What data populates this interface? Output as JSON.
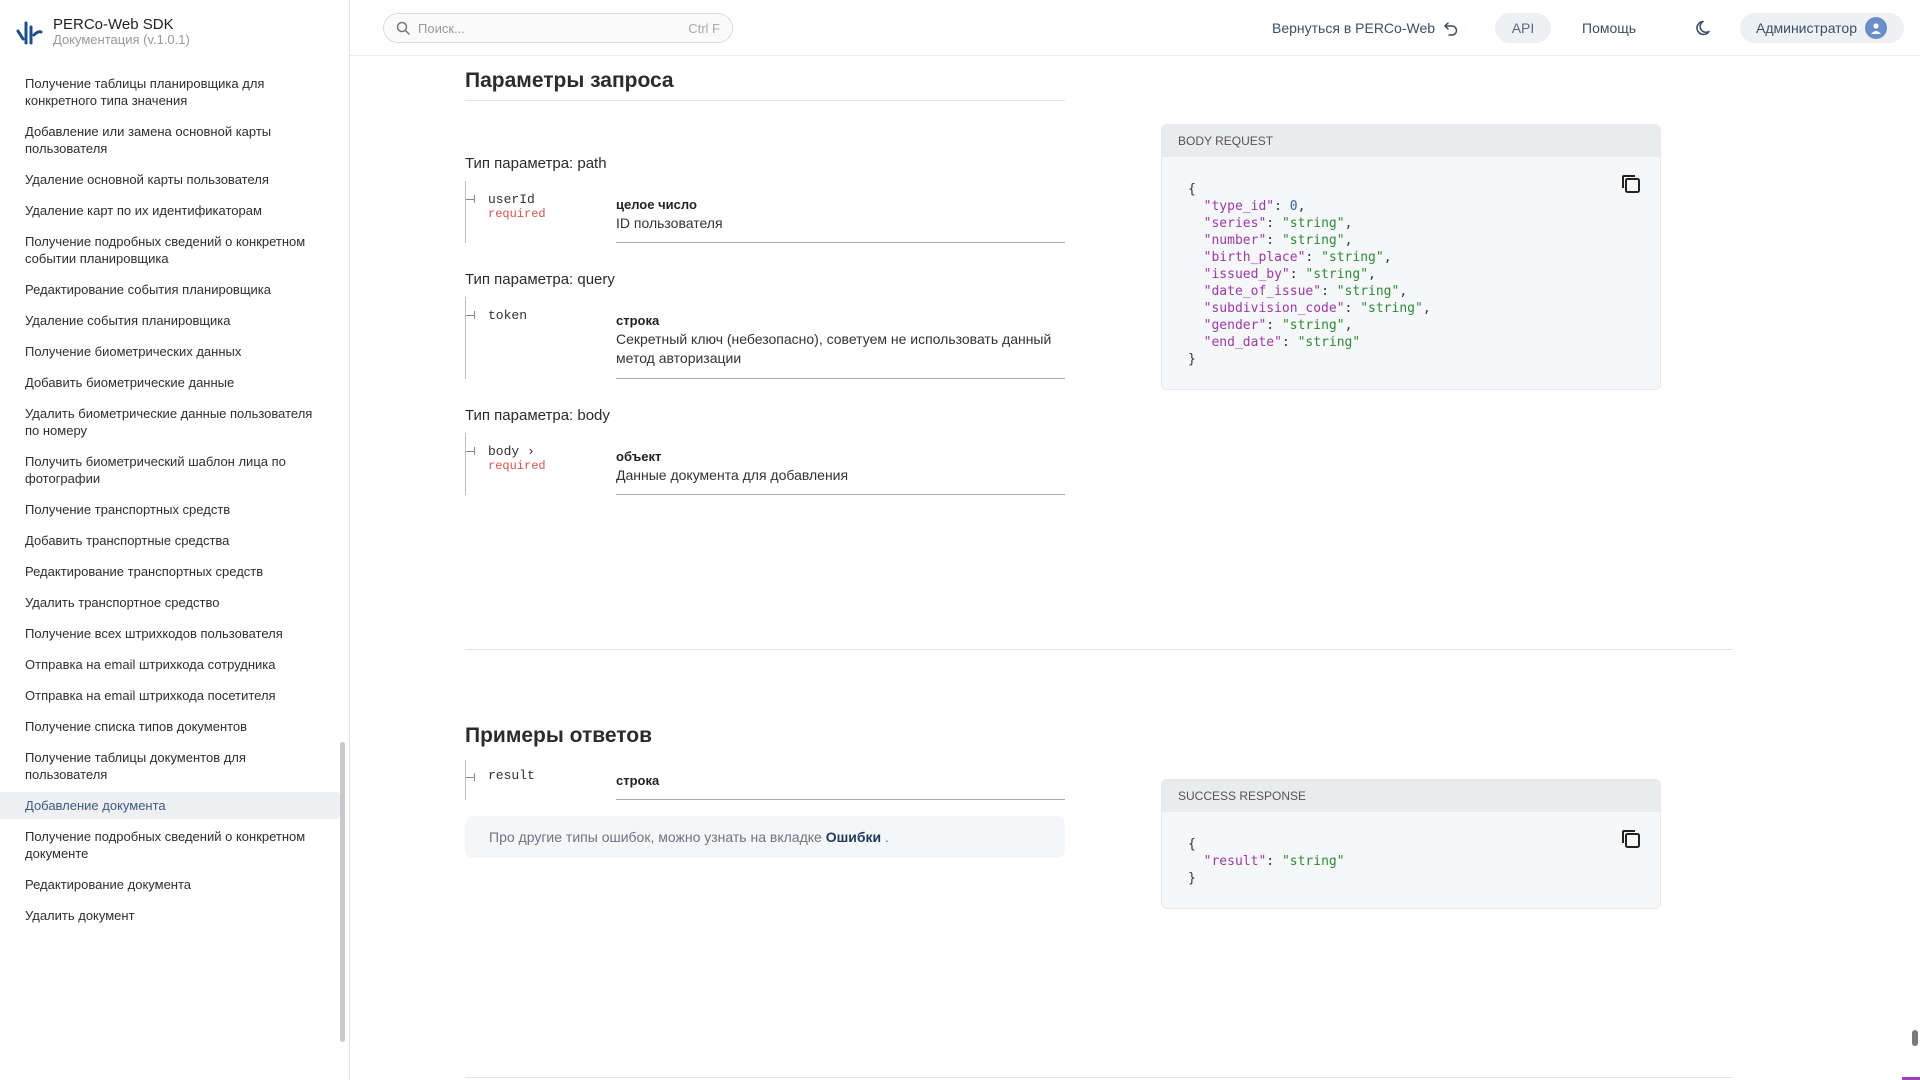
{
  "brand": {
    "title": "PERCo-Web SDK",
    "subtitle": "Документация (v.1.0.1)"
  },
  "sidebar": {
    "items": [
      {
        "label": "Получение таблицы планировщика для конкретного типа значения"
      },
      {
        "label": "Добавление или замена основной карты пользователя"
      },
      {
        "label": "Удаление основной карты пользователя"
      },
      {
        "label": "Удаление карт по их идентификаторам"
      },
      {
        "label": "Получение подробных сведений о конкретном событии планировщика"
      },
      {
        "label": "Редактирование события планировщика"
      },
      {
        "label": "Удаление события планировщика"
      },
      {
        "label": "Получение биометрических данных"
      },
      {
        "label": "Добавить биометрические данные"
      },
      {
        "label": "Удалить биометрические данные пользователя по номеру"
      },
      {
        "label": "Получить биометрический шаблон лица по фотографии"
      },
      {
        "label": "Получение транспортных средств"
      },
      {
        "label": "Добавить транспортные средства"
      },
      {
        "label": "Редактирование транспортных средств"
      },
      {
        "label": "Удалить транспортное средство"
      },
      {
        "label": "Получение всех штрихкодов пользователя"
      },
      {
        "label": "Отправка на email штрихкода сотрудника"
      },
      {
        "label": "Отправка на email штрихкода посетителя"
      },
      {
        "label": "Получение списка типов документов"
      },
      {
        "label": "Получение таблицы документов для пользователя"
      },
      {
        "label": "Добавление документа"
      },
      {
        "label": "Получение подробных сведений о конкретном документе"
      },
      {
        "label": "Редактирование документа"
      },
      {
        "label": "Удалить документ"
      }
    ],
    "active_index": 20
  },
  "header": {
    "search_placeholder": "Поиск...",
    "search_shortcut": "Ctrl F",
    "back_label": "Вернуться в PERCo-Web",
    "api_label": "API",
    "help_label": "Помощь",
    "user_label": "Администратор"
  },
  "request": {
    "title": "Параметры запроса",
    "groups": [
      {
        "type_label": "Тип параметра: path",
        "name": "userId",
        "required": "required",
        "type": "целое число",
        "desc": "ID пользователя"
      },
      {
        "type_label": "Тип параметра: query",
        "name": "token",
        "required": "",
        "type": "строка",
        "desc": "Секретный ключ (небезопасно), советуем не использовать данный метод авторизации"
      },
      {
        "type_label": "Тип параметра: body",
        "name": "body ›",
        "required": "required",
        "type": "объект",
        "desc": "Данные документа для добавления"
      }
    ],
    "body_panel_title": "BODY REQUEST"
  },
  "responses": {
    "title": "Примеры ответов",
    "param_name": "result",
    "param_type": "строка",
    "note_prefix": "Про другие типы ошибок, можно узнать на вкладке",
    "note_link": "Ошибки",
    "note_suffix": ".",
    "panel_title": "SUCCESS RESPONSE"
  },
  "colors": {
    "accent": "#3c5a80",
    "required": "#d9534f",
    "json_key": "#9b3aa6",
    "json_string": "#2e8a3a",
    "json_number": "#2e5fb0"
  },
  "icons": {
    "logo": "perco-logo-icon",
    "search": "search-icon",
    "back": "undo-arrow-icon",
    "theme": "moon-icon",
    "avatar": "user-avatar-icon",
    "copy": "copy-icon"
  }
}
